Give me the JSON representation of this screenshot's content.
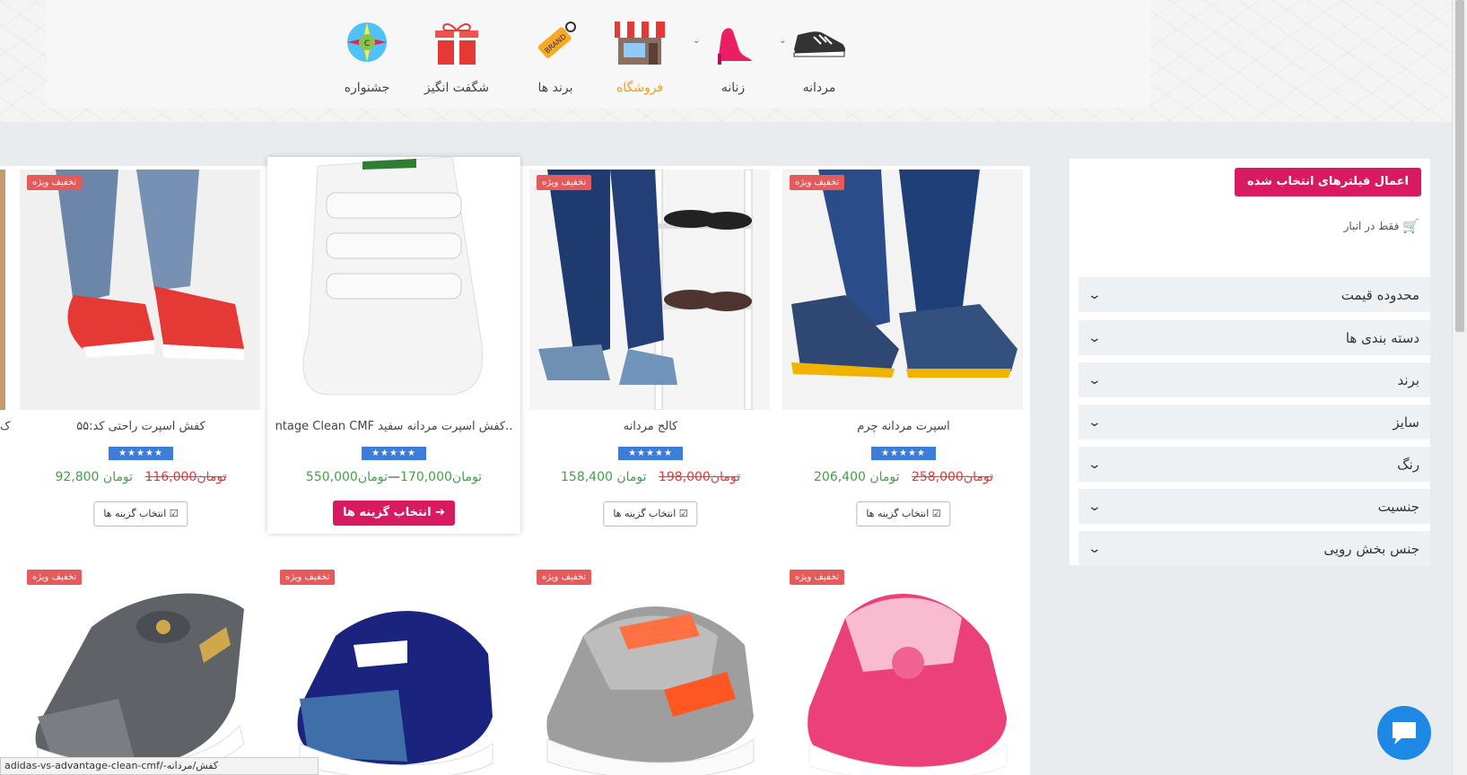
{
  "menu": {
    "items": [
      {
        "label": "مردانه",
        "icon": "men-shoe-icon"
      },
      {
        "label": "زنانه",
        "icon": "women-shoe-icon"
      },
      {
        "label": "فروشگاه",
        "icon": "shop-icon"
      },
      {
        "label": "برند ها",
        "icon": "brand-tag-icon"
      },
      {
        "label": "شگفت انگیز",
        "icon": "gift-icon"
      },
      {
        "label": "جشنواره",
        "icon": "festival-icon"
      }
    ],
    "active_color": "#f59a23"
  },
  "sidebar": {
    "apply_label": "اعمال فیلترهای انتخاب شده",
    "instock_label": "فقط در انبار",
    "filters": [
      "محدوده قیمت",
      "دسته بندی ها",
      "برند",
      "سایز",
      "رنگ",
      "جنسیت",
      "جنس بخش رویی"
    ]
  },
  "products": [
    {
      "title": "اسپرت مردانه چرم",
      "badge": "تخفیف ویژه",
      "old_price": "258,000",
      "new_price": "206,400",
      "currency": "تومان",
      "button": "انتخاب گزینه ها"
    },
    {
      "title": "کالج مردانه",
      "badge": "تخفیف ویژه",
      "old_price": "198,000",
      "new_price": "158,400",
      "currency": "تومان",
      "button": "انتخاب گزینه ها"
    },
    {
      "title": "..کفش اسپرت مردانه سفید ntage Clean CMF",
      "badge": "",
      "price_range_low": "170,000",
      "price_range_high": "550,000",
      "currency": "تومان",
      "button": "انتخاب گزینه ها"
    },
    {
      "title": "کفش اسپرت راحتی کد:۵۵",
      "badge": "تخفیف ویژه",
      "old_price": "116,000",
      "new_price": "92,800",
      "currency": "تومان",
      "button": "انتخاب گزینه ها"
    }
  ],
  "row2_badges": [
    "تخفیف ویژه",
    "تخفیف ویژه",
    "تخفیف ویژه",
    "تخفیف ویژه"
  ],
  "stars_text": "★★★★★",
  "status_url": "adidas-vs-advantage-clean-cmf/-کفش/مردانه",
  "partial_title": "ک"
}
